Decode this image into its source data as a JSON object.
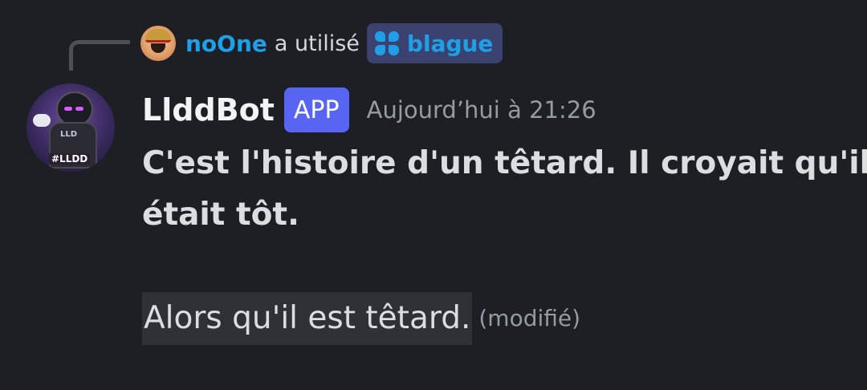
{
  "command": {
    "user": "noOne",
    "used_text": "a utilisé",
    "command_name": "blague",
    "icon": "app-command-icon"
  },
  "message": {
    "username": "LlddBot",
    "badge": "APP",
    "timestamp": "Aujourd’hui à 21:26",
    "line1": "C'est l'histoire d'un têtard. Il croyait qu'il",
    "line2": "était tôt.",
    "line3": "Alors qu'il est têtard.",
    "edited": "(modifié)"
  },
  "avatar": {
    "chest_text": "LLD",
    "tag_text": "#LLDD"
  },
  "colors": {
    "background": "#1e1f24",
    "mention_blue": "#1ea0e8",
    "app_badge": "#5865f2",
    "command_pill": "#3c4270",
    "muted_text": "#949ba4",
    "body_text": "#dbdee1"
  }
}
